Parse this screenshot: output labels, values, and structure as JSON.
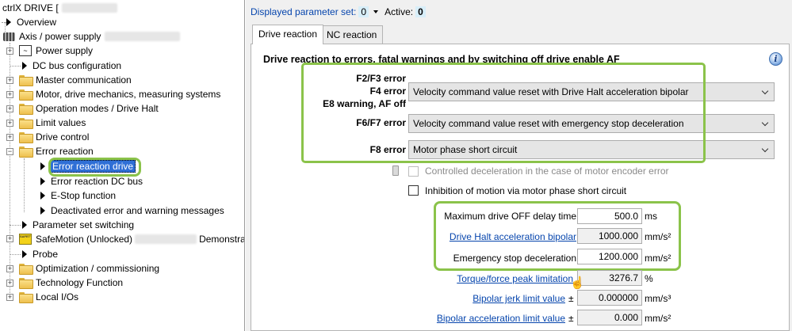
{
  "tree": {
    "title": "ctrlX DRIVE [",
    "overview": "Overview",
    "axis": "Axis / power supply",
    "power_supply": "Power supply",
    "dc_bus": "DC bus configuration",
    "master_comm": "Master communication",
    "motor": "Motor, drive mechanics, measuring systems",
    "op_modes": "Operation modes / Drive Halt",
    "limit": "Limit values",
    "drive_control": "Drive control",
    "error_reaction": "Error reaction",
    "err_drive": "Error reaction drive",
    "err_dcbus": "Error reaction DC bus",
    "estop": "E-Stop function",
    "deactivated": "Deactivated error and warning messages",
    "param_set_switching": "Parameter set switching",
    "safemotion": "SafeMotion (Unlocked)",
    "safemotion_suffix": "Demonstrat",
    "probe": "Probe",
    "optimization": "Optimization / commissioning",
    "technology": "Technology Function",
    "local_io": "Local I/Os",
    "safe_icon_text": "SAFETY ON BOARD"
  },
  "header": {
    "pset_label": "Displayed parameter set:",
    "pset_value": "0",
    "active_label": "Active:",
    "active_value": "0"
  },
  "tabs": {
    "drive_reaction": "Drive reaction",
    "nc_reaction": "NC reaction"
  },
  "section": {
    "title": "Drive reaction to errors, fatal warnings and by switching off drive enable AF"
  },
  "reactions": {
    "f2f3": "F2/F3 error",
    "f4": "F4 error",
    "e8": "E8 warning, AF off",
    "combo1": "Velocity command value reset with Drive Halt acceleration bipolar",
    "f6f7": "F6/F7 error",
    "combo2": "Velocity command value reset with emergency stop deceleration",
    "f8": "F8 error",
    "combo3": "Motor phase short circuit"
  },
  "checks": {
    "controlled_decel": "Controlled deceleration in the case of motor encoder error",
    "inhibition": "Inhibition of motion via motor phase short circuit"
  },
  "params": {
    "max_off_label": "Maximum drive OFF delay time",
    "max_off_value": "500.0",
    "max_off_unit": "ms",
    "halt_acc_label": "Drive Halt acceleration bipolar",
    "halt_acc_value": "1000.000",
    "halt_acc_unit": "mm/s²",
    "estop_decel_label": "Emergency stop deceleration",
    "estop_decel_value": "1200.000",
    "estop_decel_unit": "mm/s²",
    "torque_label": "Torque/force peak limitation",
    "torque_value": "3276.7",
    "torque_unit": "%",
    "jerk_label": "Bipolar jerk limit value",
    "jerk_sign": "±",
    "jerk_value": "0.000000",
    "jerk_unit": "mm/s³",
    "acc_limit_label": "Bipolar acceleration limit value",
    "acc_limit_sign": "±",
    "acc_limit_value": "0.000",
    "acc_limit_unit": "mm/s²"
  },
  "colors": {
    "highlight_green": "#8bc34a",
    "selection_blue": "#2f6fd6",
    "link_blue": "#0645ad",
    "value_field_bg": "#d7eef9"
  }
}
